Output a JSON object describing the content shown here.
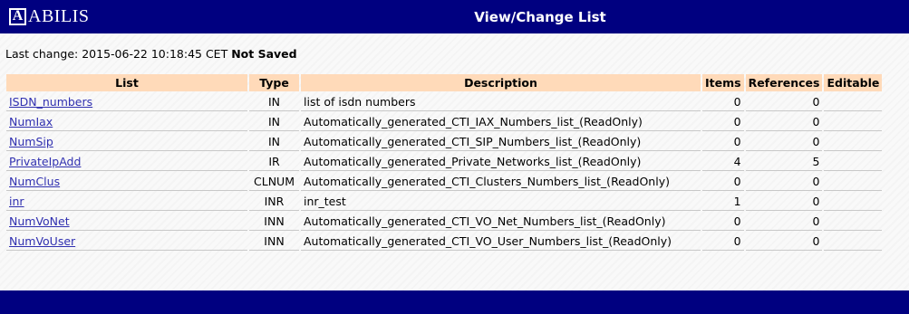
{
  "header": {
    "logo_letter": "A",
    "logo_text": "ABILIS",
    "title": "View/Change List"
  },
  "status": {
    "label": "Last change:",
    "timestamp": "2015-06-22 10:18:45 CET",
    "saved_state": "Not Saved"
  },
  "table": {
    "columns": [
      "List",
      "Type",
      "Description",
      "Items",
      "References",
      "Editable"
    ],
    "rows": [
      {
        "list": "ISDN_numbers",
        "type": "IN",
        "description": "list of isdn numbers",
        "items": "0",
        "references": "0",
        "editable": ""
      },
      {
        "list": "NumIax",
        "type": "IN",
        "description": "Automatically_generated_CTI_IAX_Numbers_list_(ReadOnly)",
        "items": "0",
        "references": "0",
        "editable": ""
      },
      {
        "list": "NumSip",
        "type": "IN",
        "description": "Automatically_generated_CTI_SIP_Numbers_list_(ReadOnly)",
        "items": "0",
        "references": "0",
        "editable": ""
      },
      {
        "list": "PrivateIpAdd",
        "type": "IR",
        "description": "Automatically_generated_Private_Networks_list_(ReadOnly)",
        "items": "4",
        "references": "5",
        "editable": ""
      },
      {
        "list": "NumClus",
        "type": "CLNUM",
        "description": "Automatically_generated_CTI_Clusters_Numbers_list_(ReadOnly)",
        "items": "0",
        "references": "0",
        "editable": ""
      },
      {
        "list": "inr",
        "type": "INR",
        "description": "inr_test",
        "items": "1",
        "references": "0",
        "editable": ""
      },
      {
        "list": "NumVoNet",
        "type": "INN",
        "description": "Automatically_generated_CTI_VO_Net_Numbers_list_(ReadOnly)",
        "items": "0",
        "references": "0",
        "editable": ""
      },
      {
        "list": "NumVoUser",
        "type": "INN",
        "description": "Automatically_generated_CTI_VO_User_Numbers_list_(ReadOnly)",
        "items": "0",
        "references": "0",
        "editable": ""
      }
    ]
  },
  "colors": {
    "header_bg": "#000080",
    "table_header_bg": "#ffdab9",
    "link": "#3030b0"
  }
}
